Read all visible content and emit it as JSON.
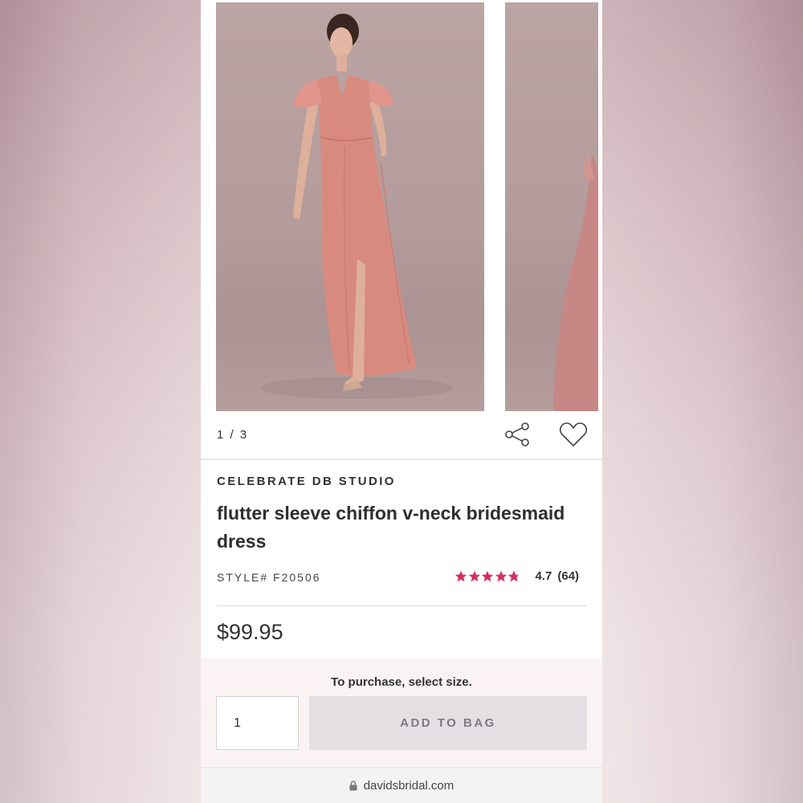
{
  "gallery": {
    "counter": "1 / 3",
    "images": [
      {
        "alt": "model wearing pink flutter sleeve chiffon dress, front view"
      },
      {
        "alt": "model wearing pink dress, side view (partially visible)"
      }
    ],
    "share_icon": "share-icon",
    "favorite_icon": "heart-icon"
  },
  "product": {
    "brand": "CELEBRATE DB STUDIO",
    "title": "flutter sleeve chiffon v-neck bridesmaid dress",
    "style": "STYLE# F20506",
    "rating": {
      "stars": 4.7,
      "value_label": "4.7",
      "count_label": "(64)",
      "star_color": "#d6305a"
    },
    "price": "$99.95"
  },
  "purchase": {
    "message": "To purchase, select size.",
    "quantity": "1",
    "add_to_bag_label": "ADD TO BAG"
  },
  "browser": {
    "url": "davidsbridal.com",
    "lock_icon": "lock-icon"
  },
  "colors": {
    "dress": "#d98a7f",
    "backdrop": "#b8a1a2",
    "rating_stars": "#d6305a",
    "add_button_bg": "#e4dfe3",
    "panel_bg": "#fbf3f3"
  }
}
